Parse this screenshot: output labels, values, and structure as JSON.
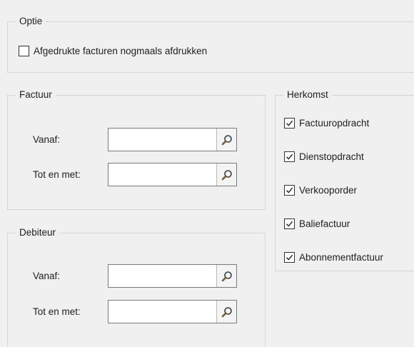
{
  "optie": {
    "title": "Optie",
    "reprint_label": "Afgedrukte facturen nogmaals afdrukken",
    "reprint_checked": false
  },
  "factuur": {
    "title": "Factuur",
    "from_label": "Vanaf:",
    "from_value": "",
    "to_label": "Tot en met:",
    "to_value": ""
  },
  "debiteur": {
    "title": "Debiteur",
    "from_label": "Vanaf:",
    "from_value": "",
    "to_label": "Tot en met:",
    "to_value": ""
  },
  "herkomst": {
    "title": "Herkomst",
    "items": [
      {
        "label": "Factuuropdracht",
        "checked": true
      },
      {
        "label": "Dienstopdracht",
        "checked": true
      },
      {
        "label": "Verkooporder",
        "checked": true
      },
      {
        "label": "Baliefactuur",
        "checked": true
      },
      {
        "label": "Abonnementfactuur",
        "checked": true
      }
    ]
  },
  "icons": {
    "lookup": "magnifier-icon",
    "check": "checkmark-icon"
  }
}
